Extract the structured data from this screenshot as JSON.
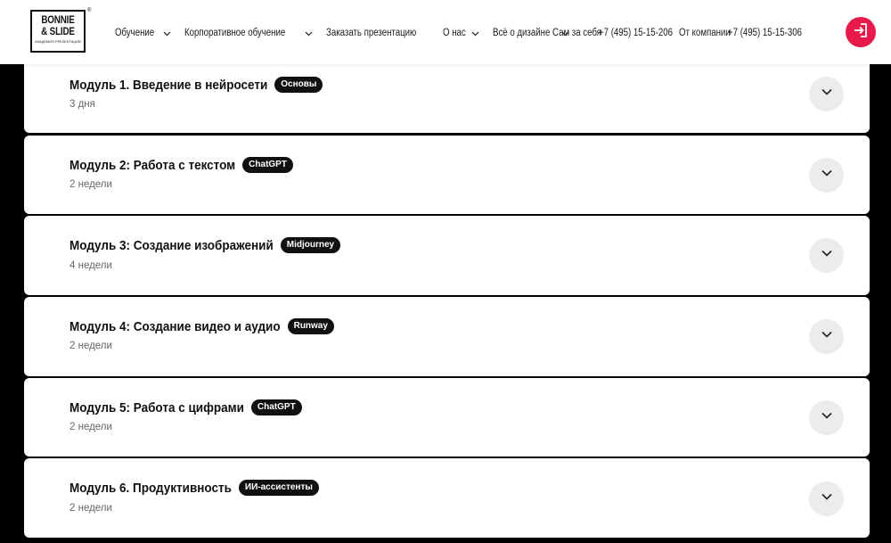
{
  "header": {
    "logo_line1": "BONNIE",
    "logo_line2": "& SLIDE",
    "logo_tagline": "АКАДЕМИЯ ПРЕЗЕНТАЦИЙ",
    "logo_reg": "®",
    "nav": [
      {
        "label": "Обучение",
        "has_dropdown": true
      },
      {
        "label": "Корпоративное обучение",
        "has_dropdown": true
      },
      {
        "label": "Заказать презентацию",
        "has_dropdown": false
      },
      {
        "label": "О нас",
        "has_dropdown": true
      },
      {
        "label": "Всё о дизайне",
        "has_dropdown": true
      }
    ],
    "contacts": {
      "self_label": "Сам за себя",
      "self_phone": "+7 (495) 15-15-206",
      "company_label": "От компании",
      "company_phone": "+7 (495) 15-15-306"
    },
    "login_icon": "login-icon",
    "accent_color": "#e8194b"
  },
  "modules": [
    {
      "title": "Модуль 1. Введение в нейросети",
      "tag": "Основы",
      "duration": "3 дня"
    },
    {
      "title": "Модуль 2: Работа с текстом",
      "tag": "ChatGPT",
      "duration": "2 недели"
    },
    {
      "title": "Модуль 3: Создание изображений",
      "tag": "Midjourney",
      "duration": "4 недели"
    },
    {
      "title": "Модуль 4: Создание видео и аудио",
      "tag": "Runway",
      "duration": "2 недели"
    },
    {
      "title": "Модуль 5: Работа с цифрами",
      "tag": "ChatGPT",
      "duration": "2 недели"
    },
    {
      "title": "Модуль 6. Продуктивность",
      "tag": "ИИ-ассистенты",
      "duration": "2 недели"
    }
  ]
}
